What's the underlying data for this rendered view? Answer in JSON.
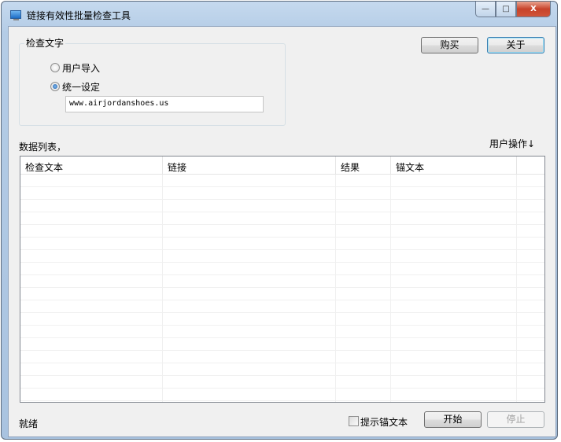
{
  "window": {
    "title": "链接有效性批量检查工具",
    "minimize": "—",
    "maximize": "□",
    "close": "X"
  },
  "group": {
    "legend": "检查文字",
    "radio_import": "用户导入",
    "radio_uniform": "统一设定",
    "selected": "radio_uniform",
    "url_value": "www.airjordanshoes.us"
  },
  "buttons": {
    "buy": "购买",
    "about": "关于",
    "start": "开始",
    "stop": "停止"
  },
  "list": {
    "label": "数据列表，",
    "user_ops": "用户操作↓",
    "columns": [
      "检查文本",
      "链接",
      "结果",
      "锚文本",
      ""
    ],
    "rows": []
  },
  "status": {
    "text": "就绪",
    "show_anchor": "提示锚文本",
    "show_anchor_checked": false
  }
}
